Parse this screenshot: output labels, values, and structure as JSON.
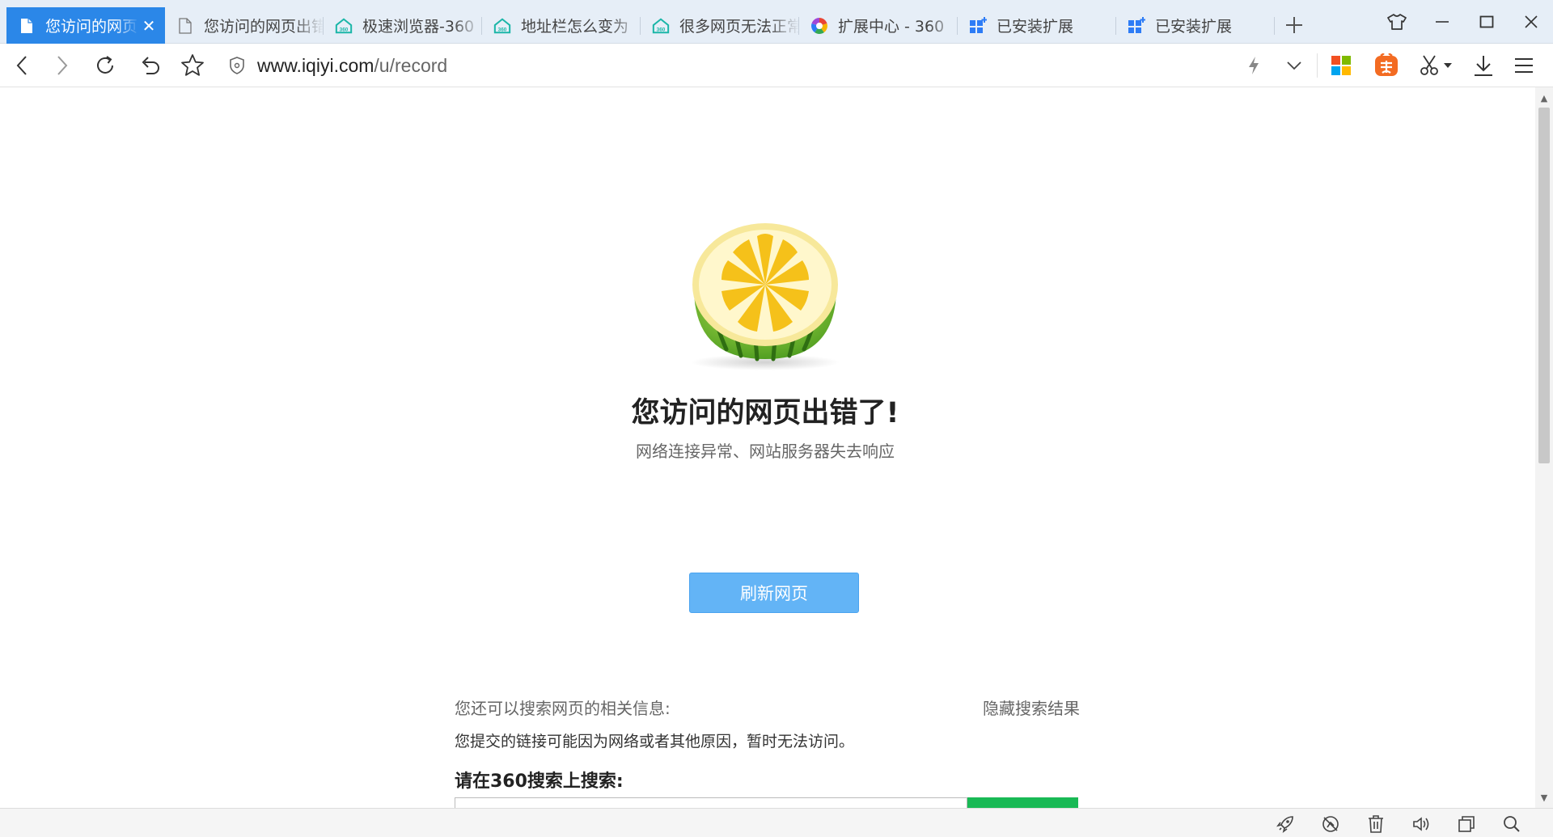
{
  "tabs": [
    {
      "label": "您访问的网页出错了",
      "icon": "document-icon",
      "active": true
    },
    {
      "label": "您访问的网页出错了",
      "icon": "document-icon",
      "active": false
    },
    {
      "label": "极速浏览器-360",
      "icon": "360-browser-icon",
      "active": false
    },
    {
      "label": "地址栏怎么变为",
      "icon": "360-browser-icon",
      "active": false
    },
    {
      "label": "很多网页无法正常",
      "icon": "360-browser-icon",
      "active": false
    },
    {
      "label": "扩展中心 - 360",
      "icon": "extension-center-icon",
      "active": false
    },
    {
      "label": "已安装扩展",
      "icon": "extensions-icon",
      "active": false
    },
    {
      "label": "已安装扩展",
      "icon": "extensions-icon",
      "active": false
    }
  ],
  "address": {
    "host": "www.iqiyi.com",
    "path": "/u/record"
  },
  "error": {
    "title": "您访问的网页出错了!",
    "subtitle": "网络连接异常、网站服务器失去响应",
    "refresh_label": "刷新网页"
  },
  "search": {
    "hint": "您还可以搜索网页的相关信息:",
    "hide_label": "隐藏搜索结果",
    "reason": "您提交的链接可能因为网络或者其他原因，暂时无法访问。",
    "search_on": "请在360搜索上搜索:"
  },
  "colors": {
    "active_tab": "#2b87e8",
    "refresh_button": "#63b4f6",
    "search_button": "#19b955"
  }
}
